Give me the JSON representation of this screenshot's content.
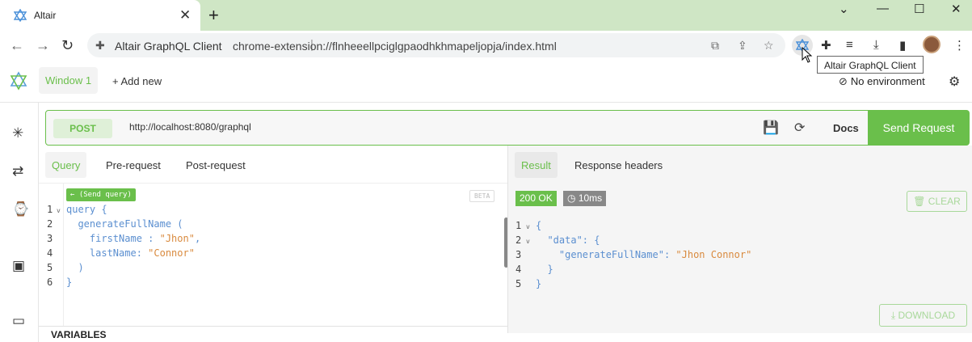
{
  "browser": {
    "tab_title": "Altair",
    "site_name": "Altair GraphQL Client",
    "url": "chrome-extension://flnheeellpciglgpaodhkhmapeljopja/index.html",
    "tooltip": "Altair GraphQL Client"
  },
  "app": {
    "window_tab": "Window 1",
    "add_new": "+ Add new",
    "environment": "No environment",
    "accent_color": "#6abf4b"
  },
  "request": {
    "method": "POST",
    "url": "http://localhost:8080/graphql",
    "docs_label": "Docs",
    "send_label": "Send Request"
  },
  "query_pane": {
    "tabs": [
      "Query",
      "Pre-request",
      "Post-request"
    ],
    "send_query_label": "← (Send query)",
    "beta_label": "BETA",
    "line_numbers": [
      "1",
      "2",
      "3",
      "4",
      "5",
      "6"
    ],
    "code": {
      "l1": "query {",
      "l2": "  generateFullName (",
      "l3_key": "    firstName : ",
      "l3_val": "\"Jhon\"",
      "l3_end": ",",
      "l4_key": "    lastName: ",
      "l4_val": "\"Connor\"",
      "l5": "  )",
      "l6": "}"
    },
    "variables_label": "VARIABLES"
  },
  "result_pane": {
    "tabs": [
      "Result",
      "Response headers"
    ],
    "status": "200 OK",
    "time": "10ms",
    "clear_label": "CLEAR",
    "download_label": "DOWNLOAD",
    "line_numbers": [
      "1",
      "2",
      "3",
      "4",
      "5"
    ],
    "code": {
      "l1": "{",
      "l2_key": "  \"data\"",
      "l2_end": ": {",
      "l3_key": "    \"generateFullName\"",
      "l3_sep": ": ",
      "l3_val": "\"Jhon Connor\"",
      "l4": "  }",
      "l5": "}"
    }
  }
}
